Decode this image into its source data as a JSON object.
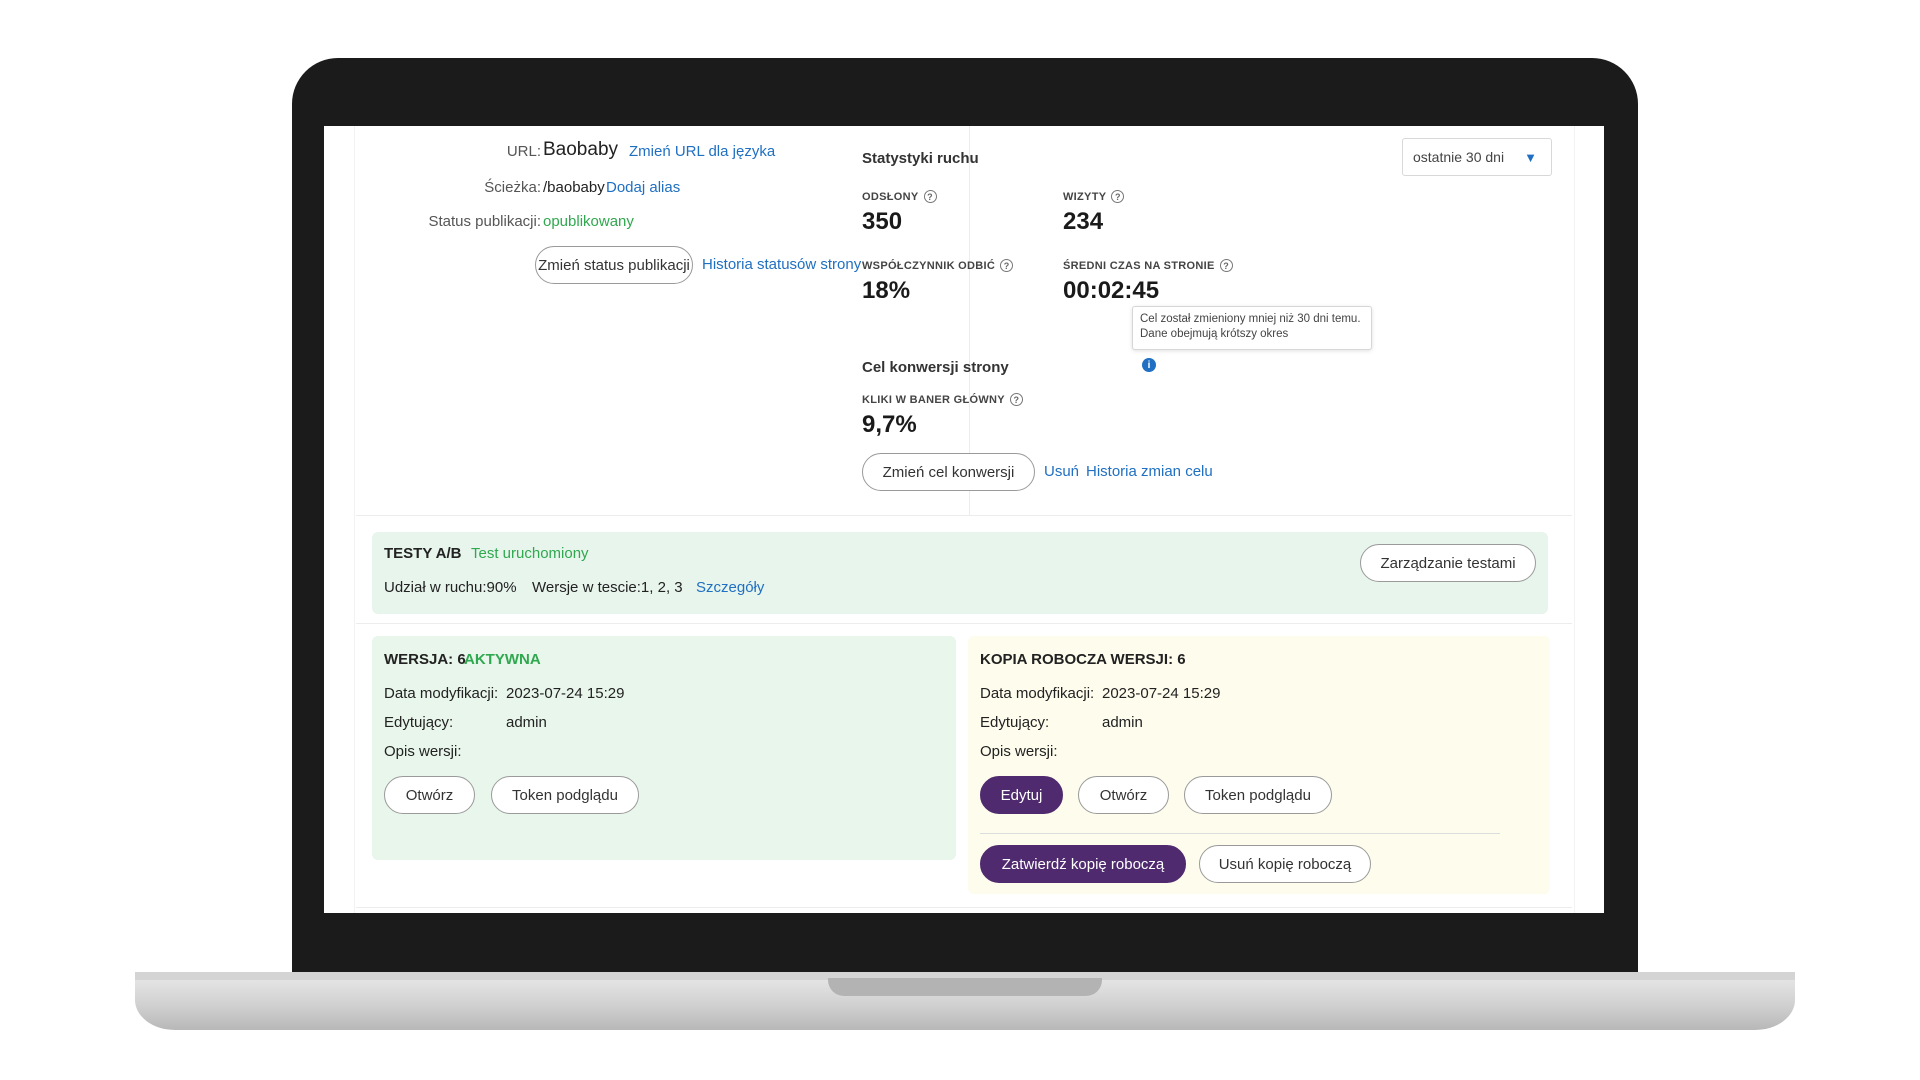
{
  "url": {
    "label": "URL:",
    "value": "Baobaby",
    "change_link": "Zmień URL dla języka"
  },
  "path": {
    "label": "Ścieżka:",
    "value": "/baobaby",
    "alias_link": "Dodaj alias"
  },
  "publication": {
    "label": "Status publikacji:",
    "value": "opublikowany",
    "change_button": "Zmień status publikacji",
    "history_link": "Historia statusów strony"
  },
  "traffic": {
    "title": "Statystyki ruchu",
    "period": "ostatnie 30 dni",
    "stats": [
      {
        "label": "ODSŁONY",
        "value": "350"
      },
      {
        "label": "WIZYTY",
        "value": "234"
      },
      {
        "label": "WSPÓŁCZYNNIK ODBIĆ",
        "value": "18%"
      },
      {
        "label": "ŚREDNI CZAS NA STRONIE",
        "value": "00:02:45"
      }
    ]
  },
  "conversion": {
    "title": "Cel konwersji strony",
    "tooltip": "Cel został zmieniony mniej niż 30 dni temu. Dane obejmują krótszy okres",
    "metric_label": "KLIKI W BANER GŁÓWNY",
    "metric_value": "9,7%",
    "change_button": "Zmień cel konwersji",
    "remove_link": "Usuń",
    "history_link": "Historia zmian celu"
  },
  "ab_tests": {
    "title": "TESTY A/B",
    "status": "Test uruchomiony",
    "traffic_share": "Udział w ruchu:90%",
    "versions": "Wersje w tescie:1, 2, 3",
    "details_link": "Szczegóły",
    "manage_button": "Zarządzanie testami"
  },
  "version": {
    "title": "WERSJA: 6",
    "status": "AKTYWNA",
    "modified_label": "Data modyfikacji:",
    "modified_value": "2023-07-24 15:29",
    "editor_label": "Edytujący:",
    "editor_value": "admin",
    "description_label": "Opis wersji:",
    "open_button": "Otwórz",
    "token_button": "Token podglądu"
  },
  "draft": {
    "title": "KOPIA ROBOCZA WERSJI: 6",
    "modified_label": "Data modyfikacji:",
    "modified_value": "2023-07-24 15:29",
    "editor_label": "Edytujący:",
    "editor_value": "admin",
    "description_label": "Opis wersji:",
    "edit_button": "Edytuj",
    "open_button": "Otwórz",
    "token_button": "Token podglądu",
    "approve_button": "Zatwierdź kopię roboczą",
    "delete_button": "Usuń kopię roboczą"
  },
  "colors": {
    "accent_purple": "#4f2a6e",
    "link_blue": "#1f6fc2",
    "status_green": "#2fa84f",
    "ab_panel_bg": "#e8f5ec",
    "draft_panel_bg": "#fefcec"
  }
}
